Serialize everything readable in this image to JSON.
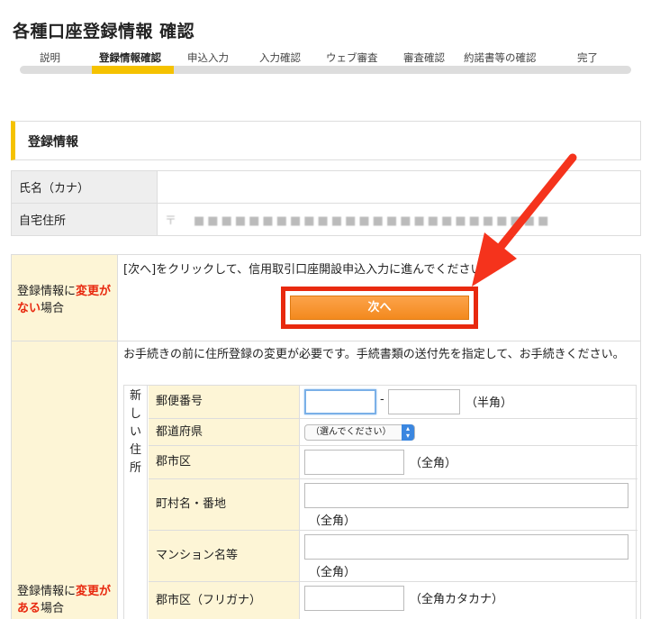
{
  "page": {
    "title": "各種口座登録情報 確認"
  },
  "steps": {
    "items": [
      "説明",
      "登録情報確認",
      "申込入力",
      "入力確認",
      "ウェブ審査",
      "審査確認",
      "約諾書等の確認",
      "完了"
    ],
    "active_index": 1
  },
  "section": {
    "heading": "登録情報"
  },
  "info": {
    "name_label": "氏名（カナ）",
    "name_value": "",
    "address_label": "自宅住所",
    "address_value": "〒　■■■■■■■■■■■■■■■■■■■■■■■■■■"
  },
  "no_change": {
    "label_prefix": "登録情報に",
    "label_red": "変更がない",
    "label_suffix": "場合",
    "description": "[次へ]をクリックして、信用取引口座開設申込入力に進んでください。",
    "next_button": "次へ"
  },
  "with_change": {
    "label_prefix": "登録情報に",
    "label_red": "変更がある",
    "label_suffix": "場合",
    "description": "お手続きの前に住所登録の変更が必要です。手続書類の送付先を指定して、お手続きください。"
  },
  "address_form": {
    "side_label": "新しい住所",
    "postal_label": "郵便番号",
    "postal_sep": "-",
    "postal_note": "（半角）",
    "pref_label": "都道府県",
    "pref_select": "（選んでください）",
    "city_label": "郡市区",
    "city_note": "（全角）",
    "town_label": "町村名・番地",
    "town_note": "（全角）",
    "building_label": "マンション名等",
    "building_note": "（全角）",
    "city_kana_label": "郡市区（フリガナ）",
    "city_kana_note": "（全角カタカナ）"
  },
  "colors": {
    "accent": "#f5c200",
    "highlight": "#e8290f",
    "button": "#f38a1e",
    "label_bg": "#fdf5d6"
  }
}
